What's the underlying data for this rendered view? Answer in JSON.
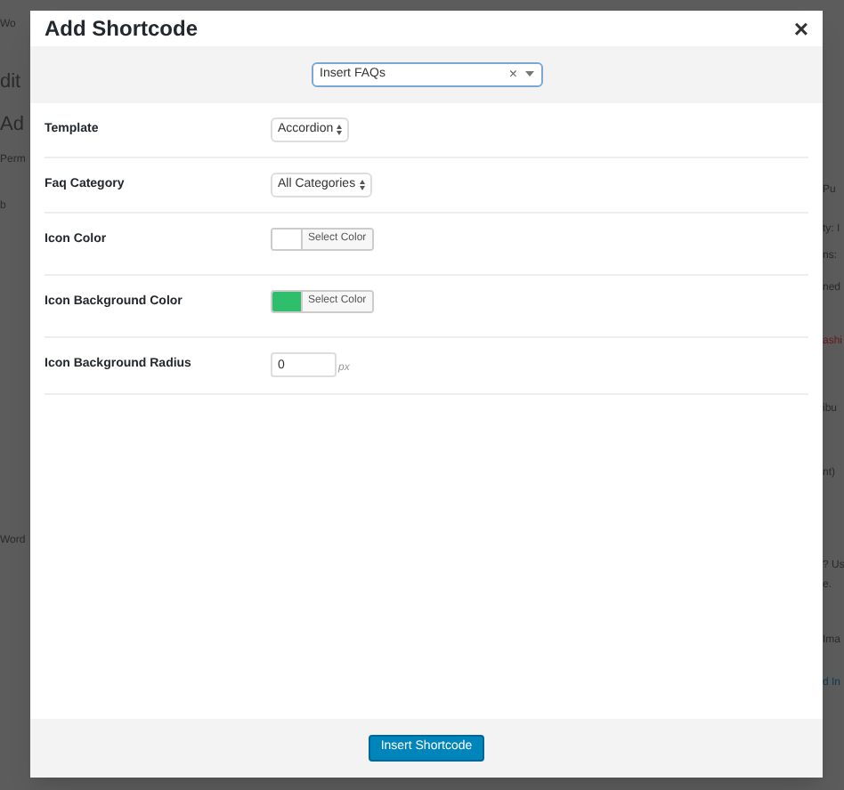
{
  "backdrop": {
    "left": [
      "Wo",
      "dit",
      "Ad",
      "Perm",
      "b",
      "Word"
    ],
    "right": [
      "Pu",
      "ty: I",
      "ns:",
      "ned",
      "ashi",
      "ibu",
      "nt)",
      "? Us",
      "e.",
      "Ima",
      "d In"
    ]
  },
  "dialog": {
    "title": "Add Shortcode",
    "close": "×",
    "shortcode_select": {
      "value": "Insert FAQs",
      "clear": "×"
    },
    "fields": [
      {
        "kind": "select",
        "label": "Template",
        "value": "Accordion"
      },
      {
        "kind": "select",
        "label": "Faq Category",
        "value": "All Categories"
      },
      {
        "kind": "color",
        "label": "Icon Color",
        "button": "Select Color",
        "color": "#ffffff"
      },
      {
        "kind": "color",
        "label": "Icon Background Color",
        "button": "Select Color",
        "color": "#2fbf6a"
      },
      {
        "kind": "number",
        "label": "Icon Background Radius",
        "value": "0",
        "unit": "px"
      }
    ],
    "submit": "Insert Shortcode"
  }
}
